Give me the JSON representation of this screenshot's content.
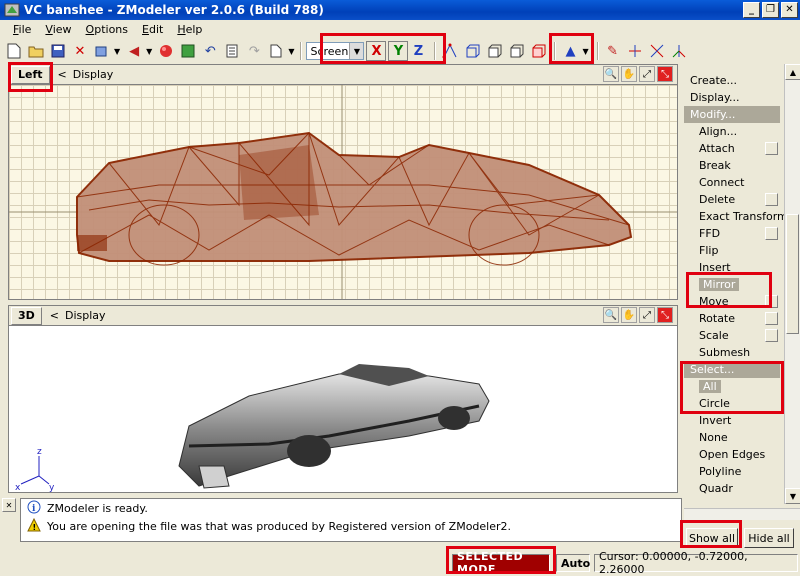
{
  "window": {
    "title": "VC banshee - ZModeler ver 2.0.6 (Build 788)"
  },
  "menu": [
    {
      "pre": "",
      "u": "F",
      "post": "ile"
    },
    {
      "pre": "",
      "u": "V",
      "post": "iew"
    },
    {
      "pre": "",
      "u": "O",
      "post": "ptions"
    },
    {
      "pre": "",
      "u": "E",
      "post": "dit"
    },
    {
      "pre": "",
      "u": "H",
      "post": "elp"
    }
  ],
  "toolbar": {
    "space_select": "Screen",
    "axis_x": "X",
    "axis_y": "Y"
  },
  "viewport_top": {
    "tab": "Left",
    "display": "Display"
  },
  "viewport_bottom": {
    "tab": "3D",
    "display": "Display"
  },
  "panel": {
    "items": [
      {
        "label": "Create...",
        "type": "top"
      },
      {
        "label": "Display...",
        "type": "top"
      },
      {
        "label": "Modify...",
        "type": "hdr"
      },
      {
        "label": "Align...",
        "type": "sub"
      },
      {
        "label": "Attach",
        "type": "sub",
        "check": true
      },
      {
        "label": "Break",
        "type": "sub"
      },
      {
        "label": "Connect",
        "type": "sub"
      },
      {
        "label": "Delete",
        "type": "sub",
        "check": true
      },
      {
        "label": "Exact Transform",
        "type": "sub"
      },
      {
        "label": "FFD",
        "type": "sub",
        "check": true
      },
      {
        "label": "Flip",
        "type": "sub"
      },
      {
        "label": "Insert",
        "type": "sub"
      },
      {
        "label": "Mirror",
        "type": "disabled"
      },
      {
        "label": "Move",
        "type": "sub",
        "check": true
      },
      {
        "label": "Rotate",
        "type": "sub",
        "check": true
      },
      {
        "label": "Scale",
        "type": "sub",
        "check": true
      },
      {
        "label": "Submesh",
        "type": "sub"
      },
      {
        "label": "Select...",
        "type": "hdr"
      },
      {
        "label": "All",
        "type": "disabled"
      },
      {
        "label": "Circle",
        "type": "sub"
      },
      {
        "label": "Invert",
        "type": "sub"
      },
      {
        "label": "None",
        "type": "sub"
      },
      {
        "label": "Open Edges",
        "type": "sub"
      },
      {
        "label": "Polyline",
        "type": "sub"
      },
      {
        "label": "Quadr",
        "type": "sub"
      }
    ],
    "show_all": "Show all",
    "hide_all": "Hide all"
  },
  "log": [
    {
      "icon": "info-icon",
      "text": "ZModeler is ready."
    },
    {
      "icon": "warning-icon",
      "text": "You are opening the file was that was produced by Registered version of ZModeler2."
    }
  ],
  "status": {
    "mode": "SELECTED MODE",
    "auto": "Auto",
    "cursor": "Cursor: 0.00000, -0.72000, 2.26000"
  },
  "colors": {
    "wireframe": "#8b2500",
    "highlight": "#e00010",
    "title_bg": "#0040b8"
  }
}
